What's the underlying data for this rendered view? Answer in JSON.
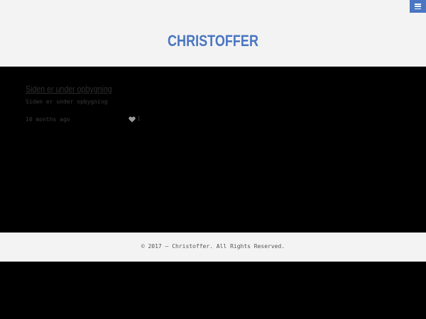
{
  "header": {
    "site_title": "CHRISTOFFER",
    "menu_icon": "hamburger-menu-icon"
  },
  "post": {
    "title": "Siden er under opbygning",
    "excerpt": "Siden er under opbygning",
    "time": "10 months ago",
    "like_icon": "heart-icon",
    "likes": "1"
  },
  "footer": {
    "copyright": "© 2017 – Christoffer. All Rights Reserved."
  },
  "colors": {
    "accent": "#4a76c2",
    "header_bg": "#f3f3f3",
    "content_bg": "#000000"
  }
}
